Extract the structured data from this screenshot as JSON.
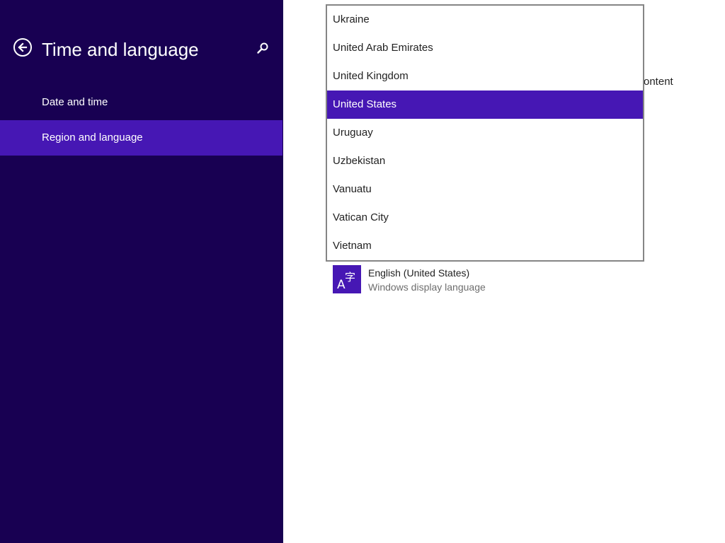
{
  "header": {
    "title": "Time and language",
    "back_icon": "back-arrow-icon",
    "search_icon": "search-icon"
  },
  "sidebar": {
    "items": [
      {
        "label": "Date and time",
        "selected": false
      },
      {
        "label": "Region and language",
        "selected": true
      }
    ]
  },
  "content": {
    "partial_text": "ontent",
    "language": {
      "name": "English (United States)",
      "description": "Windows display language",
      "icon": "language-icon"
    }
  },
  "country_dropdown": {
    "selected": "United States",
    "options": [
      "Ukraine",
      "United Arab Emirates",
      "United Kingdom",
      "United States",
      "Uruguay",
      "Uzbekistan",
      "Vanuatu",
      "Vatican City",
      "Vietnam"
    ]
  },
  "colors": {
    "sidebar_background": "#180052",
    "accent": "#4617b4",
    "content_background": "#ffffff",
    "dropdown_border": "#858585"
  }
}
